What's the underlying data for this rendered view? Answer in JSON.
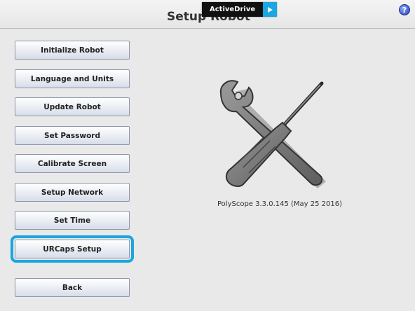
{
  "header": {
    "title": "Setup Robot",
    "active_drive_label": "ActiveDrive",
    "help_glyph": "?"
  },
  "menu": {
    "buttons": [
      {
        "label": "Initialize Robot"
      },
      {
        "label": "Language and Units"
      },
      {
        "label": "Update Robot"
      },
      {
        "label": "Set Password"
      },
      {
        "label": "Calibrate Screen"
      },
      {
        "label": "Setup Network"
      },
      {
        "label": "Set Time"
      },
      {
        "label": "URCaps Setup",
        "selected": true
      }
    ],
    "back_label": "Back"
  },
  "main": {
    "logo_icon": "wrench-screwdriver-icon",
    "version_text": "PolyScope 3.3.0.145 (May 25 2016)"
  },
  "colors": {
    "accent": "#1aa6e0",
    "background": "#e9e9e9",
    "active_drive_bg": "#111111"
  }
}
